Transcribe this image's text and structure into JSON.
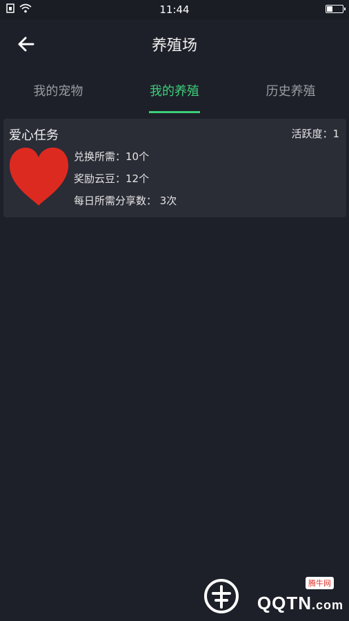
{
  "status_bar": {
    "time": "11:44"
  },
  "header": {
    "title": "养殖场"
  },
  "tabs": [
    {
      "label": "我的宠物",
      "active": false
    },
    {
      "label": "我的养殖",
      "active": true
    },
    {
      "label": "历史养殖",
      "active": false
    }
  ],
  "card": {
    "title": "爱心任务",
    "activity": "活跃度：1",
    "exchange": "兑换所需：10个",
    "reward": "奖励云豆：12个",
    "shares": "每日所需分享数： 3次"
  },
  "watermark": {
    "badge": "腾牛网",
    "text": "QQTN",
    "suffix": ".com"
  },
  "colors": {
    "accent": "#3ccf7a",
    "background": "#1e2029",
    "card": "#2a2c36",
    "heart": "#dd2a20"
  },
  "icons": {
    "back": "arrow-left-icon",
    "heart": "heart-icon"
  }
}
